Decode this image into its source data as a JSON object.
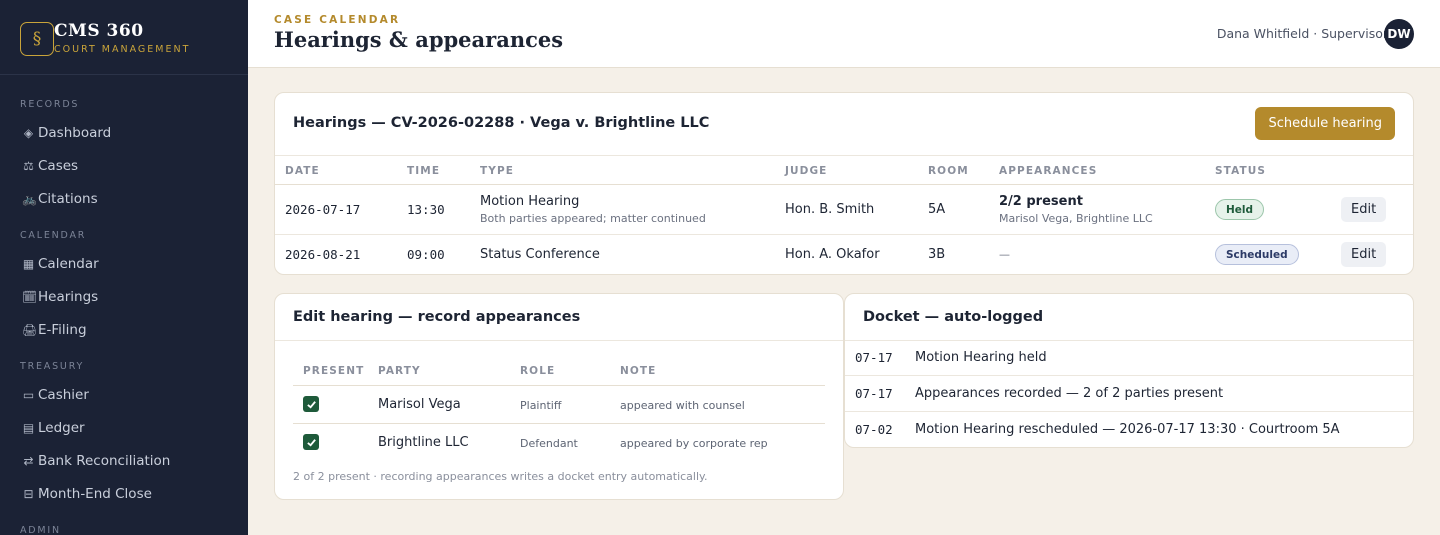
{
  "brand": {
    "logo": "§",
    "name": "CMS 360",
    "subtitle": "COURT MANAGEMENT"
  },
  "sidebar": {
    "sections": [
      {
        "label": "RECORDS",
        "items": [
          {
            "icon": "◈",
            "icon_name": "dashboard-icon",
            "label": "Dashboard"
          },
          {
            "icon": "⚖",
            "icon_name": "scales-icon",
            "label": "Cases"
          },
          {
            "icon": "🚲",
            "icon_name": "bicycle-icon",
            "label": "Citations"
          }
        ]
      },
      {
        "label": "CALENDAR",
        "items": [
          {
            "icon": "▦",
            "icon_name": "calendar-icon",
            "label": "Calendar"
          },
          {
            "icon": "🗓",
            "icon_name": "hearings-calendar-icon",
            "label": "Hearings"
          },
          {
            "icon": "🖨",
            "icon_name": "printer-icon",
            "label": "E-Filing"
          }
        ]
      },
      {
        "label": "TREASURY",
        "items": [
          {
            "icon": "▭",
            "icon_name": "cash-icon",
            "label": "Cashier"
          },
          {
            "icon": "▤",
            "icon_name": "ledger-icon",
            "label": "Ledger"
          },
          {
            "icon": "⇄",
            "icon_name": "reconcile-icon",
            "label": "Bank Reconciliation"
          },
          {
            "icon": "⊟",
            "icon_name": "close-month-icon",
            "label": "Month-End Close"
          }
        ]
      },
      {
        "label": "ADMIN",
        "items": []
      }
    ]
  },
  "header": {
    "kicker": "CASE CALENDAR",
    "title": "Hearings & appearances",
    "user": "Dana Whitfield · Supervisor",
    "avatar_initials": "DW"
  },
  "hearings": {
    "title": "Hearings — CV-2026-02288 · Vega v. Brightline LLC",
    "schedule_button": "Schedule hearing",
    "columns": [
      "DATE",
      "TIME",
      "TYPE",
      "JUDGE",
      "ROOM",
      "APPEARANCES",
      "STATUS"
    ],
    "rows": [
      {
        "date": "2026-07-17",
        "time": "13:30",
        "type": "Motion Hearing",
        "type_note": "Both parties appeared; matter continued",
        "judge": "Hon. B. Smith",
        "room": "5A",
        "appearances": "2/2 present",
        "appearances_note": "Marisol Vega, Brightline LLC",
        "status": "Held",
        "edit": "Edit"
      },
      {
        "date": "2026-08-21",
        "time": "09:00",
        "type": "Status Conference",
        "type_note": "",
        "judge": "Hon. A. Okafor",
        "room": "3B",
        "appearances": "—",
        "appearances_note": "",
        "status": "Scheduled",
        "edit": "Edit"
      }
    ]
  },
  "edit_hearing": {
    "title": "Edit hearing — record appearances",
    "columns": [
      "PRESENT",
      "PARTY",
      "ROLE",
      "NOTE"
    ],
    "rows": [
      {
        "present": true,
        "party": "Marisol Vega",
        "role": "Plaintiff",
        "note": "appeared with counsel"
      },
      {
        "present": true,
        "party": "Brightline LLC",
        "role": "Defendant",
        "note": "appeared by corporate rep"
      }
    ],
    "footnote": "2 of 2 present · recording appearances writes a docket entry automatically."
  },
  "docket": {
    "title": "Docket — auto-logged",
    "entries": [
      {
        "date": "07-17",
        "text": "Motion Hearing held"
      },
      {
        "date": "07-17",
        "text": "Appearances recorded — 2 of 2 parties present"
      },
      {
        "date": "07-02",
        "text": "Motion Hearing rescheduled — 2026-07-17 13:30 · Courtroom 5A"
      }
    ]
  },
  "colors": {
    "sidebar": "#1b2235",
    "accent": "#b48a2c",
    "held": "#1e5a3a",
    "scheduled": "#2c3a66",
    "background": "#f5f0e8"
  }
}
